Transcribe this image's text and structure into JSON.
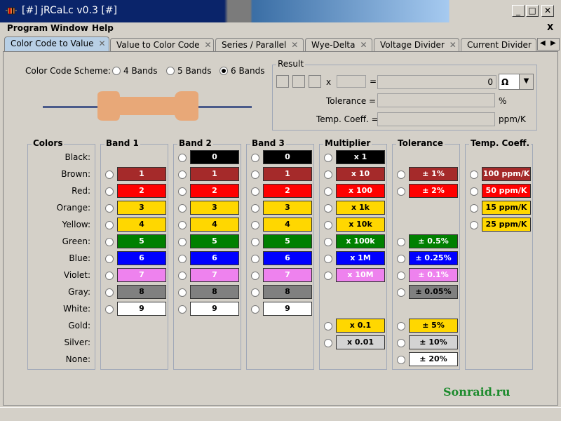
{
  "window": {
    "title": "[#] jRCaLc v0.3 [#]",
    "minimize": "_",
    "maximize": "□",
    "close": "✕"
  },
  "menu": {
    "items": [
      "Program",
      "Window",
      "Help"
    ],
    "close_label": "X"
  },
  "tabs": [
    {
      "label": "Color Code to Value",
      "active": true
    },
    {
      "label": "Value to Color Code"
    },
    {
      "label": "Series / Parallel"
    },
    {
      "label": "Wye-Delta"
    },
    {
      "label": "Voltage Divider"
    },
    {
      "label": "Current Divider"
    }
  ],
  "tab_close_glyph": "✕",
  "scheme": {
    "label": "Color Code Scheme:",
    "options": [
      "4 Bands",
      "5 Bands",
      "6 Bands"
    ],
    "selected": "6 Bands"
  },
  "result": {
    "title": "Result",
    "multiply_sign": "x",
    "equals": "=",
    "value": "0",
    "unit": "Ω",
    "tolerance_label": "Tolerance =",
    "tolerance_unit": "%",
    "tempcoeff_label": "Temp. Coeff. =",
    "tempcoeff_unit": "ppm/K"
  },
  "resistor_colors": {
    "body": "#e8a878",
    "lead": "#4a5a8a"
  },
  "groups": [
    "Colors",
    "Band 1",
    "Band 2",
    "Band 3",
    "Multiplier",
    "Tolerance",
    "Temp. Coeff."
  ],
  "color_rows": [
    "Black:",
    "Brown:",
    "Red:",
    "Orange:",
    "Yellow:",
    "Green:",
    "Blue:",
    "Violet:",
    "Gray:",
    "White:",
    "Gold:",
    "Silver:",
    "None:"
  ],
  "colors": {
    "Black": "#000000",
    "Brown": "#a52a2a",
    "Red": "#ff0000",
    "Orange": "#ffd700",
    "Yellow": "#ffd700",
    "Green": "#008000",
    "Blue": "#0000ff",
    "Violet": "#ee82ee",
    "Gray": "#808080",
    "White": "#ffffff",
    "Gold": "#ffd700",
    "Silver": "#d3d3d3",
    "None": "#ffffff"
  },
  "band1": [
    {
      "row": 1,
      "text": "1",
      "color": "#a52a2a",
      "fg": "#fff"
    },
    {
      "row": 2,
      "text": "2",
      "color": "#ff0000",
      "fg": "#fff"
    },
    {
      "row": 3,
      "text": "3",
      "color": "#ffd700",
      "fg": "#000"
    },
    {
      "row": 4,
      "text": "4",
      "color": "#ffd700",
      "fg": "#000"
    },
    {
      "row": 5,
      "text": "5",
      "color": "#008000",
      "fg": "#fff"
    },
    {
      "row": 6,
      "text": "6",
      "color": "#0000ff",
      "fg": "#fff"
    },
    {
      "row": 7,
      "text": "7",
      "color": "#ee82ee",
      "fg": "#fff"
    },
    {
      "row": 8,
      "text": "8",
      "color": "#808080",
      "fg": "#000"
    },
    {
      "row": 9,
      "text": "9",
      "color": "#ffffff",
      "fg": "#000"
    }
  ],
  "band2": [
    {
      "row": 0,
      "text": "0",
      "color": "#000000",
      "fg": "#fff"
    },
    {
      "row": 1,
      "text": "1",
      "color": "#a52a2a",
      "fg": "#fff"
    },
    {
      "row": 2,
      "text": "2",
      "color": "#ff0000",
      "fg": "#fff"
    },
    {
      "row": 3,
      "text": "3",
      "color": "#ffd700",
      "fg": "#000"
    },
    {
      "row": 4,
      "text": "4",
      "color": "#ffd700",
      "fg": "#000"
    },
    {
      "row": 5,
      "text": "5",
      "color": "#008000",
      "fg": "#fff"
    },
    {
      "row": 6,
      "text": "6",
      "color": "#0000ff",
      "fg": "#fff"
    },
    {
      "row": 7,
      "text": "7",
      "color": "#ee82ee",
      "fg": "#fff"
    },
    {
      "row": 8,
      "text": "8",
      "color": "#808080",
      "fg": "#000"
    },
    {
      "row": 9,
      "text": "9",
      "color": "#ffffff",
      "fg": "#000"
    }
  ],
  "band3": [
    {
      "row": 0,
      "text": "0",
      "color": "#000000",
      "fg": "#fff"
    },
    {
      "row": 1,
      "text": "1",
      "color": "#a52a2a",
      "fg": "#fff"
    },
    {
      "row": 2,
      "text": "2",
      "color": "#ff0000",
      "fg": "#fff"
    },
    {
      "row": 3,
      "text": "3",
      "color": "#ffd700",
      "fg": "#000"
    },
    {
      "row": 4,
      "text": "4",
      "color": "#ffd700",
      "fg": "#000"
    },
    {
      "row": 5,
      "text": "5",
      "color": "#008000",
      "fg": "#fff"
    },
    {
      "row": 6,
      "text": "6",
      "color": "#0000ff",
      "fg": "#fff"
    },
    {
      "row": 7,
      "text": "7",
      "color": "#ee82ee",
      "fg": "#fff"
    },
    {
      "row": 8,
      "text": "8",
      "color": "#808080",
      "fg": "#000"
    },
    {
      "row": 9,
      "text": "9",
      "color": "#ffffff",
      "fg": "#000"
    }
  ],
  "multiplier": [
    {
      "row": 0,
      "text": "x 1",
      "color": "#000000",
      "fg": "#fff"
    },
    {
      "row": 1,
      "text": "x 10",
      "color": "#a52a2a",
      "fg": "#fff"
    },
    {
      "row": 2,
      "text": "x 100",
      "color": "#ff0000",
      "fg": "#fff"
    },
    {
      "row": 3,
      "text": "x 1k",
      "color": "#ffd700",
      "fg": "#000"
    },
    {
      "row": 4,
      "text": "x 10k",
      "color": "#ffd700",
      "fg": "#000"
    },
    {
      "row": 5,
      "text": "x 100k",
      "color": "#008000",
      "fg": "#fff"
    },
    {
      "row": 6,
      "text": "x 1M",
      "color": "#0000ff",
      "fg": "#fff"
    },
    {
      "row": 7,
      "text": "x 10M",
      "color": "#ee82ee",
      "fg": "#fff"
    },
    {
      "row": 10,
      "text": "x 0.1",
      "color": "#ffd700",
      "fg": "#000"
    },
    {
      "row": 11,
      "text": "x 0.01",
      "color": "#d3d3d3",
      "fg": "#000"
    }
  ],
  "tolerance": [
    {
      "row": 1,
      "text": "± 1%",
      "color": "#a52a2a",
      "fg": "#fff"
    },
    {
      "row": 2,
      "text": "± 2%",
      "color": "#ff0000",
      "fg": "#fff"
    },
    {
      "row": 5,
      "text": "± 0.5%",
      "color": "#008000",
      "fg": "#fff"
    },
    {
      "row": 6,
      "text": "± 0.25%",
      "color": "#0000ff",
      "fg": "#fff"
    },
    {
      "row": 7,
      "text": "± 0.1%",
      "color": "#ee82ee",
      "fg": "#fff"
    },
    {
      "row": 8,
      "text": "± 0.05%",
      "color": "#808080",
      "fg": "#000"
    },
    {
      "row": 10,
      "text": "± 5%",
      "color": "#ffd700",
      "fg": "#000"
    },
    {
      "row": 11,
      "text": "± 10%",
      "color": "#d3d3d3",
      "fg": "#000"
    },
    {
      "row": 12,
      "text": "± 20%",
      "color": "#ffffff",
      "fg": "#000"
    }
  ],
  "tempcoeff": [
    {
      "row": 1,
      "text": "100 ppm/K",
      "color": "#a52a2a",
      "fg": "#fff"
    },
    {
      "row": 2,
      "text": "50 ppm/K",
      "color": "#ff0000",
      "fg": "#fff"
    },
    {
      "row": 3,
      "text": "15 ppm/K",
      "color": "#ffd700",
      "fg": "#000"
    },
    {
      "row": 4,
      "text": "25 ppm/K",
      "color": "#ffd700",
      "fg": "#000"
    }
  ],
  "watermark": "Sonraid.ru"
}
